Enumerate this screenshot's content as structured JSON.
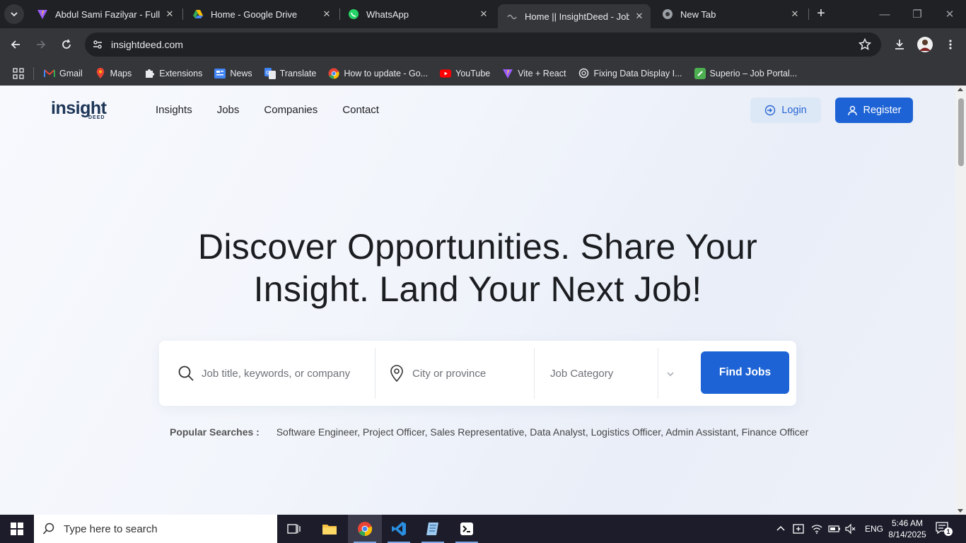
{
  "browser": {
    "tabs": [
      {
        "title": "Abdul Sami Fazilyar - Full-St",
        "icon": "vite-icon"
      },
      {
        "title": "Home - Google Drive",
        "icon": "google-drive-icon"
      },
      {
        "title": "WhatsApp",
        "icon": "whatsapp-icon"
      },
      {
        "title": "Home || InsightDeed - Job P",
        "icon": "loading-icon",
        "active": true
      },
      {
        "title": "New Tab",
        "icon": "chrome-icon"
      }
    ],
    "url": "insightdeed.com",
    "bookmarks": [
      {
        "label": "Gmail",
        "icon": "gmail-icon"
      },
      {
        "label": "Maps",
        "icon": "maps-icon"
      },
      {
        "label": "Extensions",
        "icon": "puzzle-icon"
      },
      {
        "label": "News",
        "icon": "news-icon"
      },
      {
        "label": "Translate",
        "icon": "translate-icon"
      },
      {
        "label": "How to update - Go...",
        "icon": "chrome-icon"
      },
      {
        "label": "YouTube",
        "icon": "youtube-icon"
      },
      {
        "label": "Vite + React",
        "icon": "vite-icon"
      },
      {
        "label": "Fixing Data Display I...",
        "icon": "openai-icon"
      },
      {
        "label": "Superio – Job Portal...",
        "icon": "superio-icon"
      }
    ]
  },
  "site": {
    "logo_main": "insight",
    "logo_sub": "DEED",
    "nav": [
      "Insights",
      "Jobs",
      "Companies",
      "Contact"
    ],
    "login_label": "Login",
    "register_label": "Register",
    "hero_line1": "Discover Opportunities. Share Your",
    "hero_line2": "Insight. Land Your Next Job!",
    "search": {
      "keyword_placeholder": "Job title, keywords, or company",
      "location_placeholder": "City or province",
      "category_placeholder": "Job Category",
      "button_label": "Find Jobs"
    },
    "popular_label": "Popular Searches :",
    "popular_items": [
      "Software Engineer,",
      "Project Officer,",
      "Sales Representative,",
      "Data Analyst,",
      "Logistics Officer,",
      "Admin Assistant,",
      "Finance Officer"
    ]
  },
  "colors": {
    "brand_blue": "#1d63d5",
    "login_bg": "#dde8f7",
    "logo_navy": "#1d3557"
  },
  "taskbar": {
    "search_placeholder": "Type here to search",
    "apps": [
      "task-view-icon",
      "file-explorer-icon",
      "chrome-icon",
      "vscode-icon",
      "notepad-icon",
      "terminal-icon"
    ],
    "language": "ENG",
    "time": "5:46 AM",
    "date": "8/14/2025",
    "notification_count": "1"
  }
}
